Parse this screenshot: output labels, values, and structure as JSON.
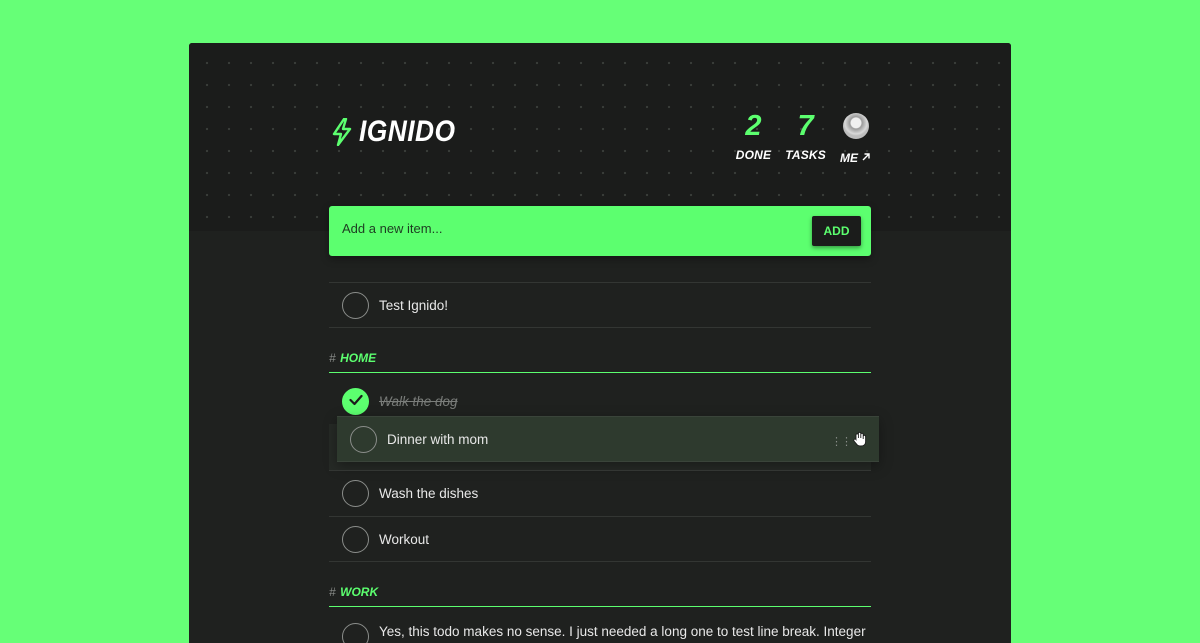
{
  "app": {
    "name": "IGNIDO",
    "accent": "#5cff6f",
    "background": "#66ff77"
  },
  "stats": {
    "done_value": "2",
    "done_label": "DONE",
    "tasks_value": "7",
    "tasks_label": "TASKS",
    "me_label": "ME"
  },
  "add_bar": {
    "placeholder": "Add a new item...",
    "button_label": "ADD"
  },
  "inbox": [
    {
      "label": "Test Ignido!",
      "done": false
    }
  ],
  "sections": [
    {
      "hash": "#",
      "name": "HOME",
      "items": [
        {
          "label": "Walk the dog",
          "done": true
        },
        {
          "label": "Dinner with mom",
          "done": false,
          "dragging": true
        },
        {
          "label": "Wash the dishes",
          "done": false
        },
        {
          "label": "Workout",
          "done": false
        }
      ]
    },
    {
      "hash": "#",
      "name": "WORK",
      "items": [
        {
          "label": "Yes, this todo makes no sense. I just needed a long one to test line break. Integer",
          "done": false
        }
      ]
    }
  ],
  "icons": {
    "logo": "lightning-bolt-icon",
    "me_link": "arrow-up-right-icon",
    "check": "checkmark-icon",
    "drag": "drag-handle-icon",
    "cursor": "grab-hand-cursor-icon"
  }
}
